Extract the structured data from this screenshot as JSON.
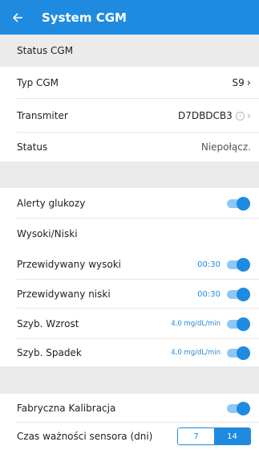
{
  "header": {
    "title": "System CGM"
  },
  "status_section": {
    "title": "Status CGM",
    "cgm_type": {
      "label": "Typ CGM",
      "value": "S9"
    },
    "transmitter": {
      "label": "Transmiter",
      "value": "D7DBDCB3",
      "info": "i"
    },
    "status": {
      "label": "Status",
      "value": "Niepołącz."
    }
  },
  "alerts": {
    "glucose_alerts": {
      "label": "Alerty glukozy",
      "on": true
    },
    "high_low": {
      "label": "Wysoki/Niski"
    },
    "predicted_high": {
      "label": "Przewidywany wysoki",
      "value": "00:30",
      "on": true
    },
    "predicted_low": {
      "label": "Przewidywany niski",
      "value": "00:30",
      "on": true
    },
    "fast_rise": {
      "label": "Szyb. Wzrost",
      "value": "4,0 mg/dL/min",
      "on": true
    },
    "fast_fall": {
      "label": "Szyb. Spadek",
      "value": "4,0 mg/dL/min",
      "on": true
    }
  },
  "calibration": {
    "factory": {
      "label": "Fabryczna Kalibracja",
      "on": true
    },
    "sensor_validity": {
      "label": "Czas ważności sensora (dni)",
      "options": [
        "7",
        "14"
      ],
      "selected": "14"
    }
  },
  "colors": {
    "accent": "#1f8be0",
    "toggle_track": "#8ec7f3",
    "divider_bg": "#ebebeb"
  }
}
